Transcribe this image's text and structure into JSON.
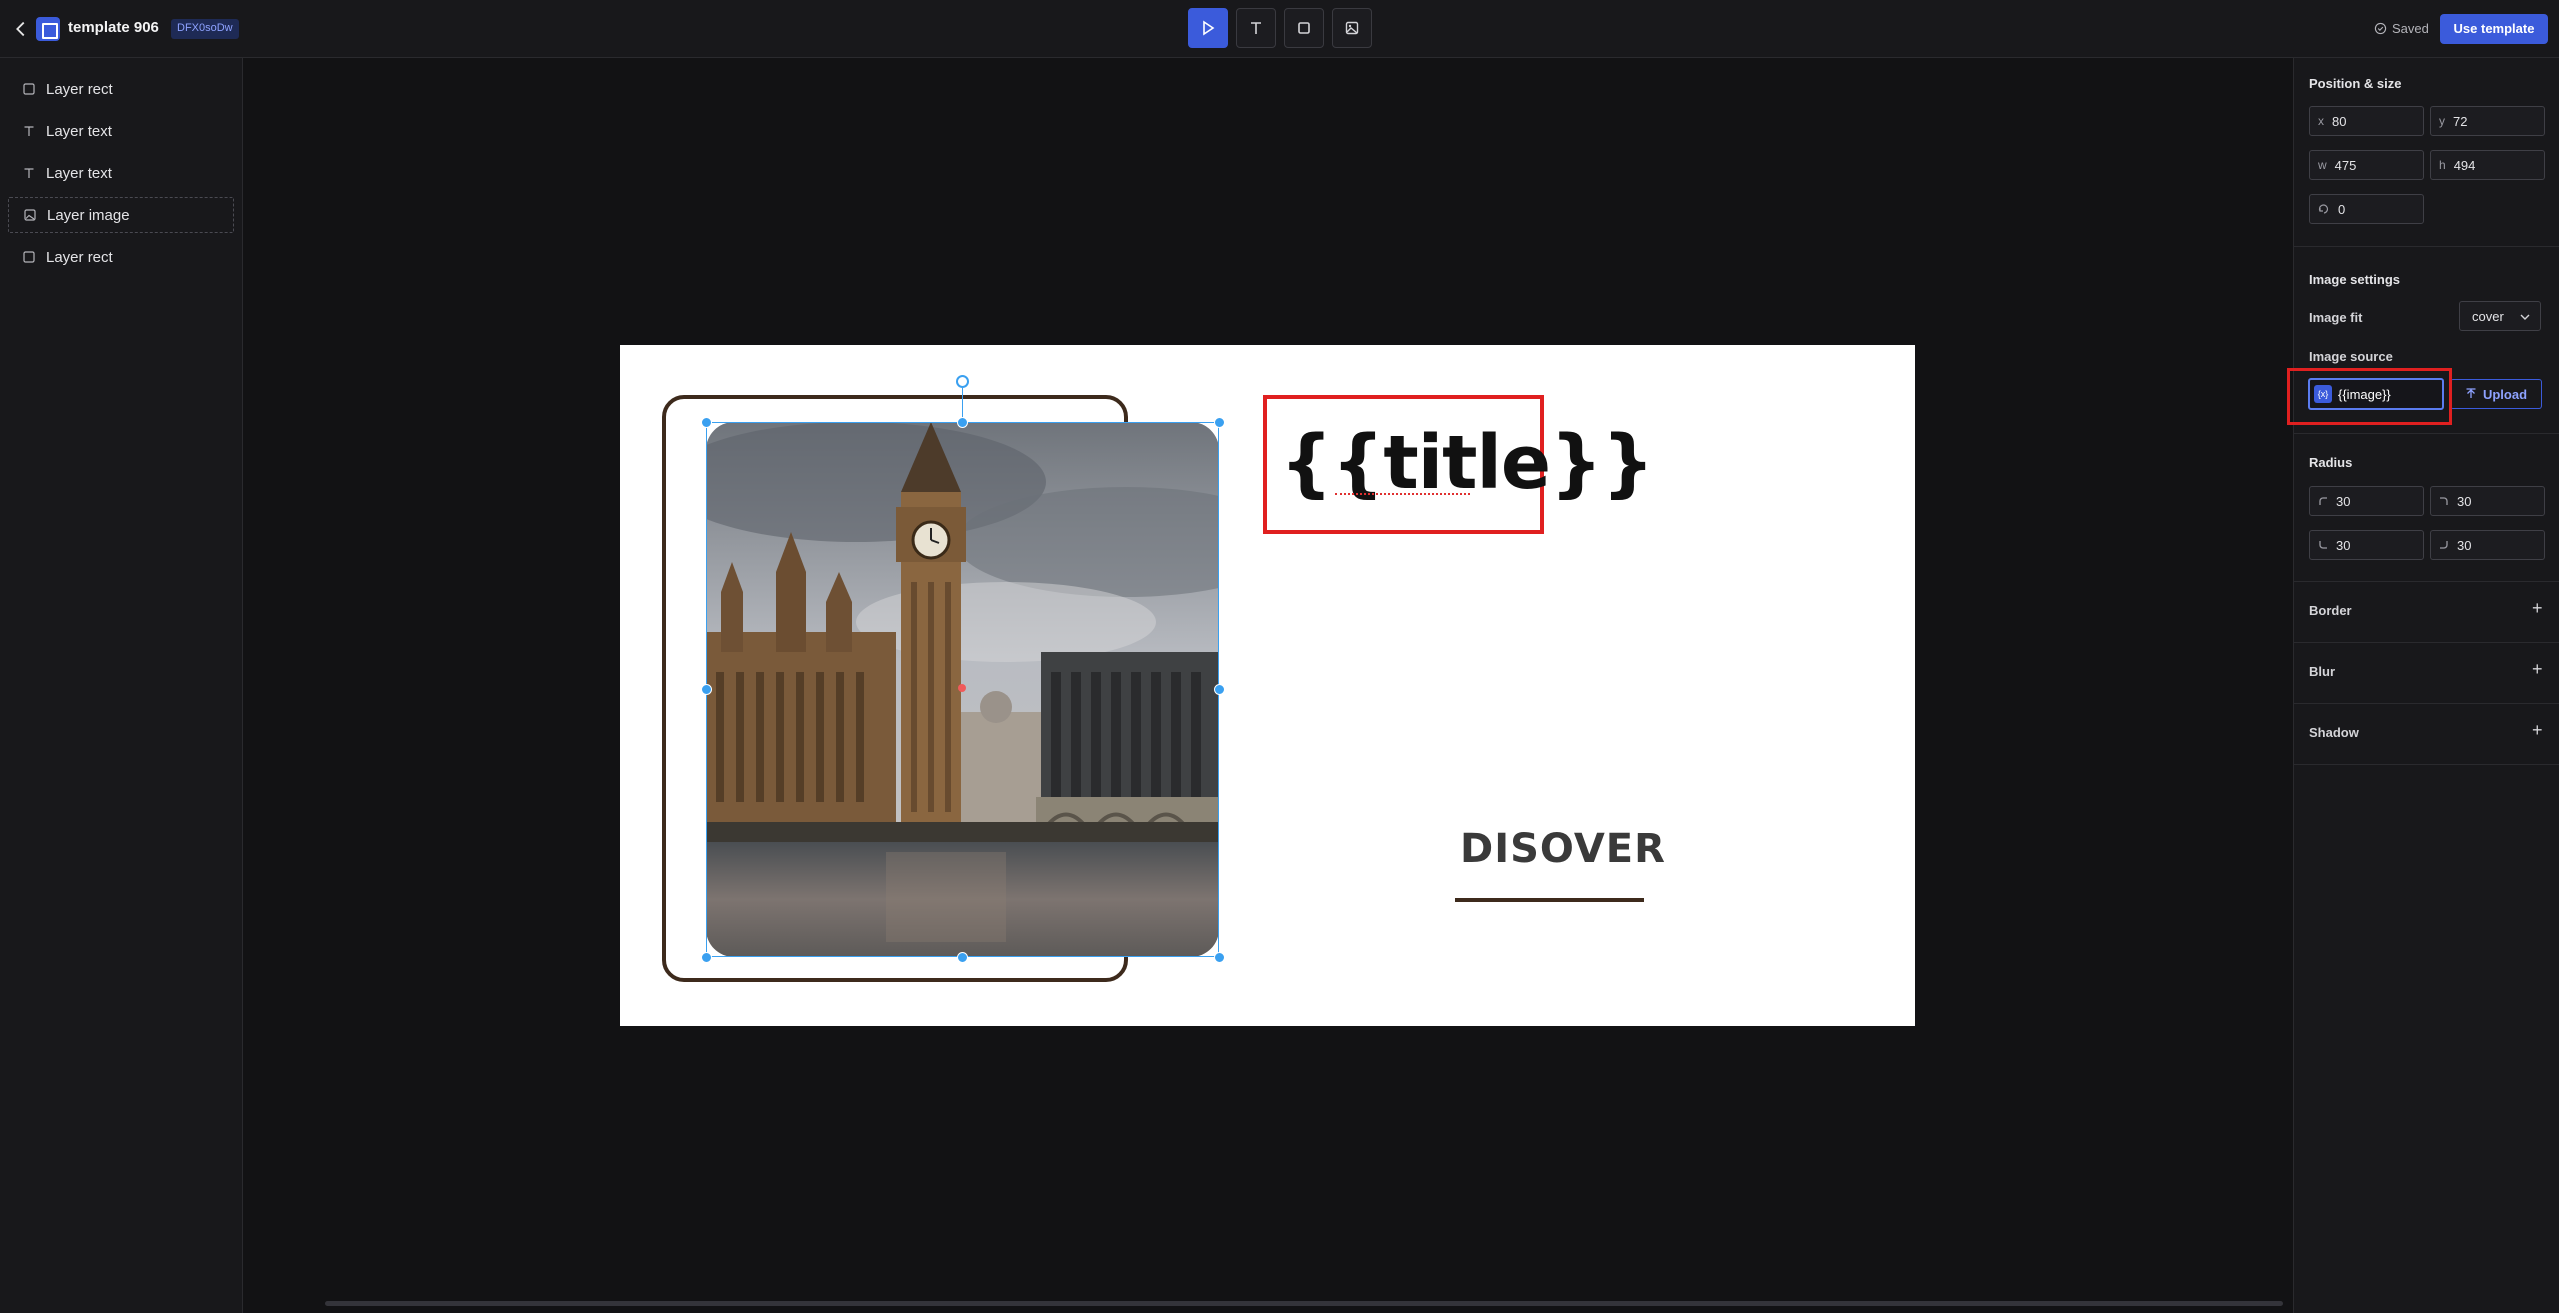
{
  "header": {
    "title": "template 906",
    "doc_id": "DFX0soDw",
    "saved_label": "Saved",
    "use_template_label": "Use template"
  },
  "toolbar": {
    "tools": [
      "select-tool",
      "text-tool",
      "rect-tool",
      "image-tool"
    ],
    "active": "select-tool"
  },
  "layers": [
    {
      "label": "Layer rect",
      "icon": "square-icon"
    },
    {
      "label": "Layer text",
      "icon": "text-icon"
    },
    {
      "label": "Layer text",
      "icon": "text-icon"
    },
    {
      "label": "Layer image",
      "icon": "image-icon"
    },
    {
      "label": "Layer rect",
      "icon": "square-icon"
    }
  ],
  "canvas": {
    "title_text": "{{title}}",
    "discover_text": "DISOVER"
  },
  "inspector": {
    "position_title": "Position & size",
    "x": {
      "label": "x",
      "value": "80"
    },
    "y": {
      "label": "y",
      "value": "72"
    },
    "w": {
      "label": "w",
      "value": "475"
    },
    "h": {
      "label": "h",
      "value": "494"
    },
    "rotation": {
      "value": "0"
    },
    "image_settings_title": "Image settings",
    "image_fit_label": "Image fit",
    "image_fit_value": "cover",
    "image_source_label": "Image source",
    "image_source_value": "{{image}}",
    "var_chip": "{x}",
    "upload_label": "Upload",
    "radius_title": "Radius",
    "radius": [
      "30",
      "30",
      "30",
      "30"
    ],
    "border_label": "Border",
    "blur_label": "Blur",
    "shadow_label": "Shadow"
  },
  "colors": {
    "accent": "#3b5bdb",
    "selection": "#3aa0f0",
    "annotation_red": "#e02020",
    "frame_brown": "#3d2a1c"
  }
}
